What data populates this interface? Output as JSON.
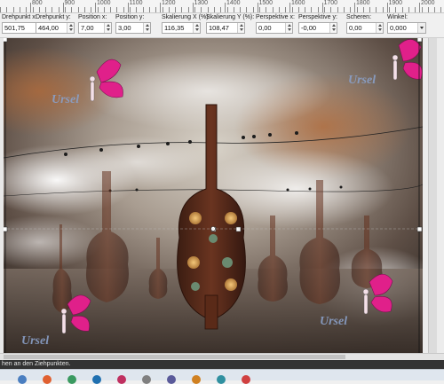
{
  "ruler": {
    "numbers": [
      "800",
      "900",
      "1000",
      "1100",
      "1200",
      "1300",
      "1400",
      "1500",
      "1600",
      "1700",
      "1800",
      "1900",
      "2000"
    ]
  },
  "toolbar": {
    "fields": [
      {
        "label": "Drehpunkt x:",
        "value": "501,75"
      },
      {
        "label": "Drehpunkt y:",
        "value": "464,00"
      },
      {
        "label": "Position x:",
        "value": "7,00"
      },
      {
        "label": "Position y:",
        "value": "3,00"
      },
      {
        "label": "Skalierung X (%):",
        "value": "116,35"
      },
      {
        "label": "Skalierung Y (%):",
        "value": "108,47"
      },
      {
        "label": "Perspektive x:",
        "value": "0,00"
      },
      {
        "label": "Perspektive y:",
        "value": "-0,00"
      },
      {
        "label": "Scheren:",
        "value": "0,00"
      },
      {
        "label": "Winkel:",
        "value": "0,000"
      }
    ]
  },
  "canvas": {
    "watermark_text": "Ursel"
  },
  "status": {
    "text": "hen an den Ziehpunkten."
  },
  "colors": {
    "toolbar_bg": "#f0f0f0",
    "status_bg": "#333333",
    "fairy_pink": "#e0208a",
    "watermark": "#8aa0c8"
  },
  "taskbar": {
    "icons": [
      "chrome-icon",
      "firefox-icon",
      "app-icon",
      "app-icon",
      "app-icon",
      "app-icon",
      "app-icon",
      "app-icon",
      "app-icon",
      "app-icon"
    ]
  }
}
